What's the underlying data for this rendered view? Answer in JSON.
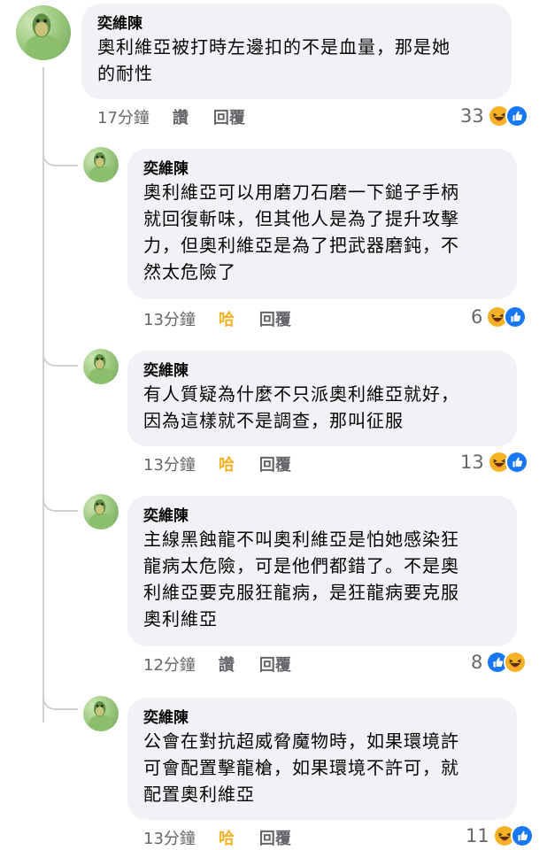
{
  "comments": [
    {
      "author": "奕維陳",
      "text": "奧利維亞被打時左邊扣的不是血量，那是她\n的耐性",
      "time": "17分鐘",
      "action": "讚",
      "reply": "回覆",
      "count": "33",
      "reactions": [
        "haha",
        "like"
      ]
    },
    {
      "author": "奕維陳",
      "text": "奧利維亞可以用磨刀石磨一下鎚子手柄\n就回復斬味，但其他人是為了提升攻擊\n力，但奧利維亞是為了把武器磨鈍，不\n然太危險了",
      "time": "13分鐘",
      "action": "哈",
      "reply": "回覆",
      "count": "6",
      "reactions": [
        "haha",
        "like"
      ]
    },
    {
      "author": "奕維陳",
      "text": "有人質疑為什麼不只派奧利維亞就好，\n因為這樣就不是調查，那叫征服",
      "time": "13分鐘",
      "action": "哈",
      "reply": "回覆",
      "count": "13",
      "reactions": [
        "haha",
        "like"
      ]
    },
    {
      "author": "奕維陳",
      "text": "主線黑蝕龍不叫奧利維亞是怕她感染狂\n龍病太危險，可是他們都錯了。不是奧\n利維亞要克服狂龍病，是狂龍病要克服\n奧利維亞",
      "time": "12分鐘",
      "action": "讚",
      "reply": "回覆",
      "count": "8",
      "reactions": [
        "like",
        "haha"
      ]
    },
    {
      "author": "奕維陳",
      "text": "公會在對抗超威脅魔物時，如果環境許\n可會配置擊龍槍，如果環境不許可，就\n配置奧利維亞",
      "time": "13分鐘",
      "action": "哈",
      "reply": "回覆",
      "count": "11",
      "reactions": [
        "haha",
        "like"
      ]
    }
  ],
  "colors": {
    "bubble": "#f0f2f5",
    "meta": "#65676b",
    "haha_action": "#f7b125",
    "like_blue": "#1877f2",
    "haha_yellow": "#f7b125"
  }
}
